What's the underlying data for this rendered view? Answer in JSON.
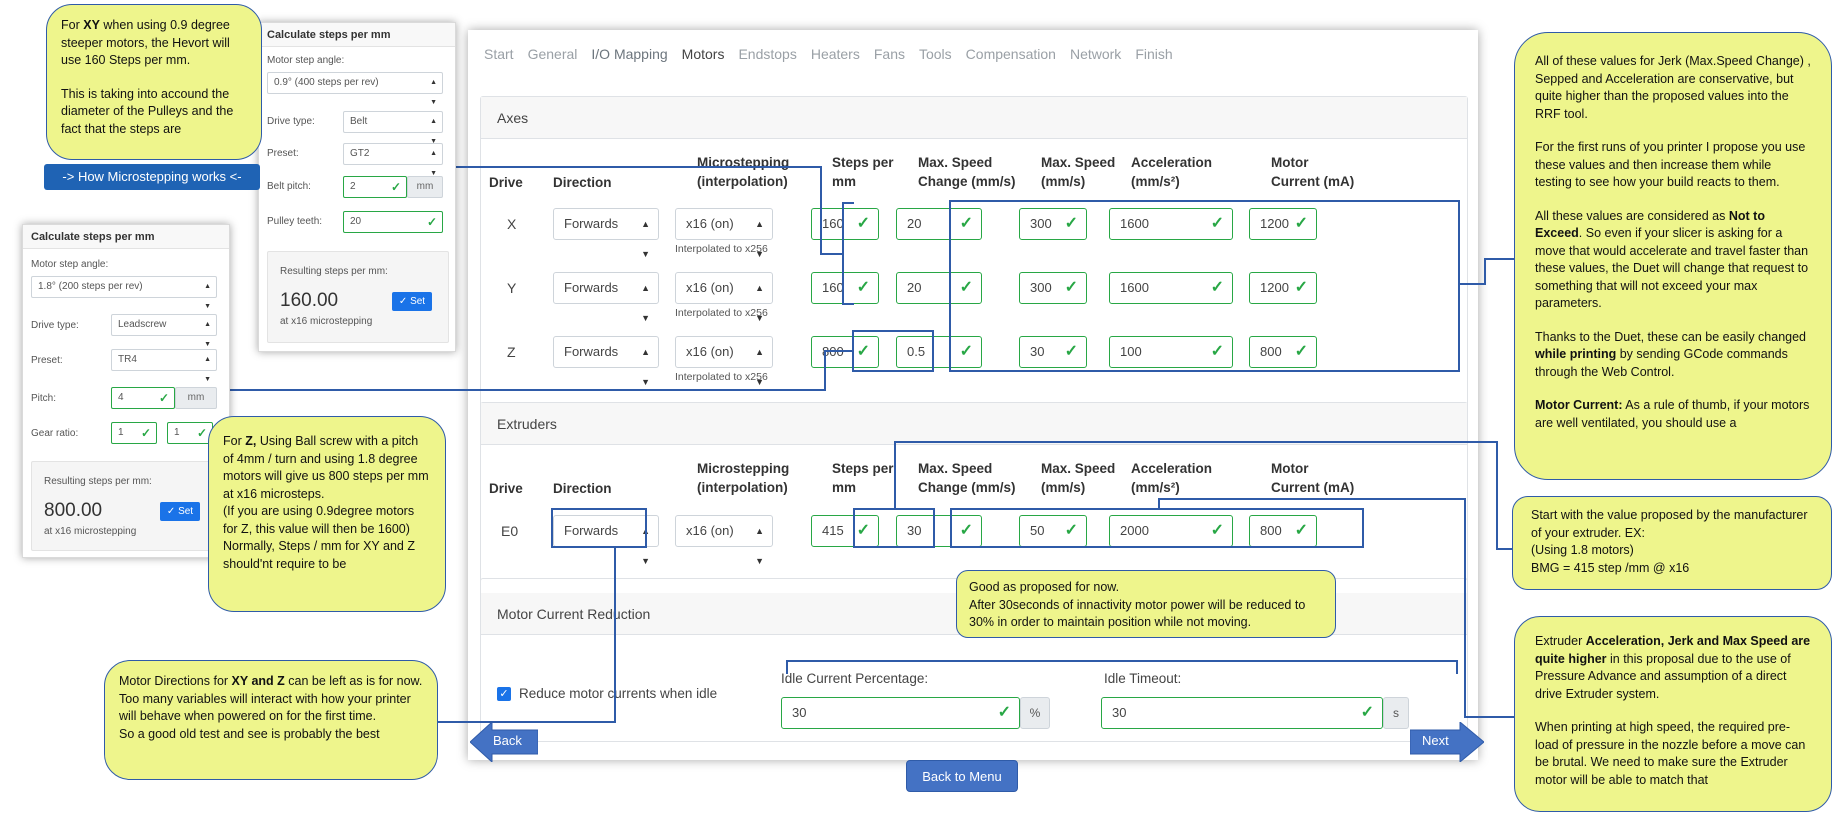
{
  "nav": {
    "tabs": [
      "Start",
      "General",
      "I/O Mapping",
      "Motors",
      "Endstops",
      "Heaters",
      "Fans",
      "Tools",
      "Compensation",
      "Network",
      "Finish"
    ],
    "active": "Motors"
  },
  "axes": {
    "title": "Axes",
    "headers": {
      "drive": "Drive",
      "direction": "Direction",
      "micro1": "Microstepping",
      "micro2": "(interpolation)",
      "steps1": "Steps per",
      "steps2": "mm",
      "msc1": "Max. Speed",
      "msc2": "Change (mm/s)",
      "ms1": "Max. Speed",
      "ms2": "(mm/s)",
      "acc1": "Acceleration",
      "acc2": "(mm/s²)",
      "cur1": "Motor",
      "cur2": "Current (mA)"
    },
    "rows": [
      {
        "drive": "X",
        "direction": "Forwards",
        "micro": "x16 (on)",
        "interp": "Interpolated to x256",
        "steps": "160",
        "msc": "20",
        "ms": "300",
        "acc": "1600",
        "cur": "1200"
      },
      {
        "drive": "Y",
        "direction": "Forwards",
        "micro": "x16 (on)",
        "interp": "Interpolated to x256",
        "steps": "160",
        "msc": "20",
        "ms": "300",
        "acc": "1600",
        "cur": "1200"
      },
      {
        "drive": "Z",
        "direction": "Forwards",
        "micro": "x16 (on)",
        "interp": "Interpolated to x256",
        "steps": "800",
        "msc": "0.5",
        "ms": "30",
        "acc": "100",
        "cur": "800"
      }
    ]
  },
  "extruders": {
    "title": "Extruders",
    "rows": [
      {
        "drive": "E0",
        "direction": "Forwards",
        "micro": "x16 (on)",
        "steps": "415",
        "msc": "30",
        "ms": "50",
        "acc": "2000",
        "cur": "800"
      }
    ]
  },
  "reduction": {
    "title": "Motor Current Reduction",
    "checkbox_label": "Reduce motor currents when idle",
    "idle_pct_label": "Idle Current Percentage:",
    "idle_pct_value": "30",
    "idle_pct_unit": "%",
    "idle_timeout_label": "Idle Timeout:",
    "idle_timeout_value": "30",
    "idle_timeout_unit": "s"
  },
  "buttons": {
    "back": "Back",
    "next": "Next",
    "menu": "Back to Menu",
    "micro": "-> How Microstepping works <-"
  },
  "calc1": {
    "title": "Calculate steps per mm",
    "angle_label": "Motor step angle:",
    "angle_value": "0.9° (400 steps per rev)",
    "drive_label": "Drive type:",
    "drive_value": "Belt",
    "preset_label": "Preset:",
    "preset_value": "GT2",
    "pitch_label": "Belt pitch:",
    "pitch_value": "2",
    "pitch_unit": "mm",
    "teeth_label": "Pulley teeth:",
    "teeth_value": "20",
    "result_label": "Resulting steps per mm:",
    "result_value": "160.00",
    "result_sub": "at x16 microstepping",
    "set": "Set"
  },
  "calc2": {
    "title": "Calculate steps per mm",
    "angle_label": "Motor step angle:",
    "angle_value": "1.8° (200 steps per rev)",
    "drive_label": "Drive type:",
    "drive_value": "Leadscrew",
    "preset_label": "Preset:",
    "preset_value": "TR4",
    "pitch_label": "Pitch:",
    "pitch_value": "4",
    "pitch_unit": "mm",
    "gear_label": "Gear ratio:",
    "gear_a": "1",
    "gear_b": "1",
    "result_label": "Resulting steps per mm:",
    "result_value": "800.00",
    "result_sub": "at x16 microstepping",
    "set": "Set"
  },
  "notes": {
    "xy": {
      "p1_pre": "For ",
      "p1_bold": "XY",
      "p1_post": " when using 0.9 degree steeper motors, the Hevort will use 160 Steps per mm.",
      "p2": "This is taking into accound the diameter of the Pulleys and the fact that the steps are"
    },
    "z": {
      "l1_pre": "For ",
      "l1_bold": "Z,",
      "l1_post": " Using Ball screw with a pitch of 4mm / turn and using 1.8 degree motors will give us 800 steps per mm at x16 microsteps.",
      "l2": "(If you are using 0.9degree motors for Z, this value will then be 1600)",
      "l3": "Normally, Steps / mm for XY and Z should'nt require to be"
    },
    "dir": {
      "l1_pre": "Motor Directions for ",
      "l1_bold": "XY and Z",
      "l1_post": " can be left as is for now.  Too many variables will interact with how your printer will behave when powered on for the first time.",
      "l2": "So a good old test and see is probably the best"
    },
    "idle": {
      "l1": "Good as proposed for now.",
      "l2": "After 30seconds of innactivity motor power will be reduced to 30% in order to maintain position while not moving."
    },
    "jerk": {
      "p1": "All of these values for Jerk (Max.Speed Change) , Sepped and Acceleration are conservative, but quite higher than the proposed values into the RRF tool.",
      "p2": "For the first runs of you printer I propose you use these values and then increase them while testing to see how your build reacts to them.",
      "p3_pre": "All these values are considered as ",
      "p3_bold": "Not to Exceed",
      "p3_post": ".  So even if your slicer is asking for a move that would accelerate and travel faster than these values, the Duet will change that request to something that will not exceed your max parameters.",
      "p4_pre": "Thanks to the Duet, these can be easily changed ",
      "p4_bold": "while printing",
      "p4_post": " by sending GCode commands through the Web Control.",
      "p5_bold": "Motor Current:",
      "p5_post": " As a rule of thumb, if your motors are well ventilated, you should use a"
    },
    "extruder_steps": {
      "l1": "Start with the value proposed by the manufacturer of your extruder. EX:",
      "l2": "(Using 1.8 motors)",
      "l3": "BMG = 415 step /mm @ x16"
    },
    "extruder_acc": {
      "p1_pre": "Extruder ",
      "p1_bold": "Acceleration, Jerk and Max Speed are quite higher",
      "p1_post": " in this proposal due to the use of Pressure Advance and assumption of a direct drive Extruder system.",
      "p2": "When printing at high speed, the required pre-load of pressure in the nozzle before a move can be brutal.  We need to make sure the Extruder motor will be able to match that"
    }
  },
  "colors": {
    "accent_green": "#28a745",
    "callout_yellow": "#eef58c",
    "connector_blue": "#2f5ba8",
    "button_blue": "#4472c4"
  }
}
